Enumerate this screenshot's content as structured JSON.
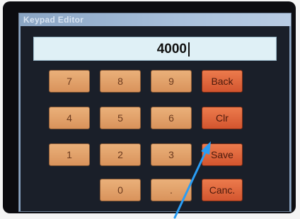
{
  "window": {
    "title": "Keypad Editor"
  },
  "display": {
    "value": "4000"
  },
  "keys": {
    "k7": "7",
    "k8": "8",
    "k9": "9",
    "back": "Back",
    "k4": "4",
    "k5": "5",
    "k6": "6",
    "clr": "Clr",
    "k1": "1",
    "k2": "2",
    "k3": "3",
    "save": "Save",
    "k0": "0",
    "dot": ".",
    "cancel": "Canc."
  },
  "colors": {
    "key_fill": "#e2a06a",
    "action_key_fill": "#e0643c",
    "display_fill": "#dff0f6",
    "titlebar": "#a9c0db",
    "annotation_arrow": "#2a9df4"
  },
  "annotation": {
    "icon": "arrow-pointer-icon",
    "target": "Save"
  }
}
